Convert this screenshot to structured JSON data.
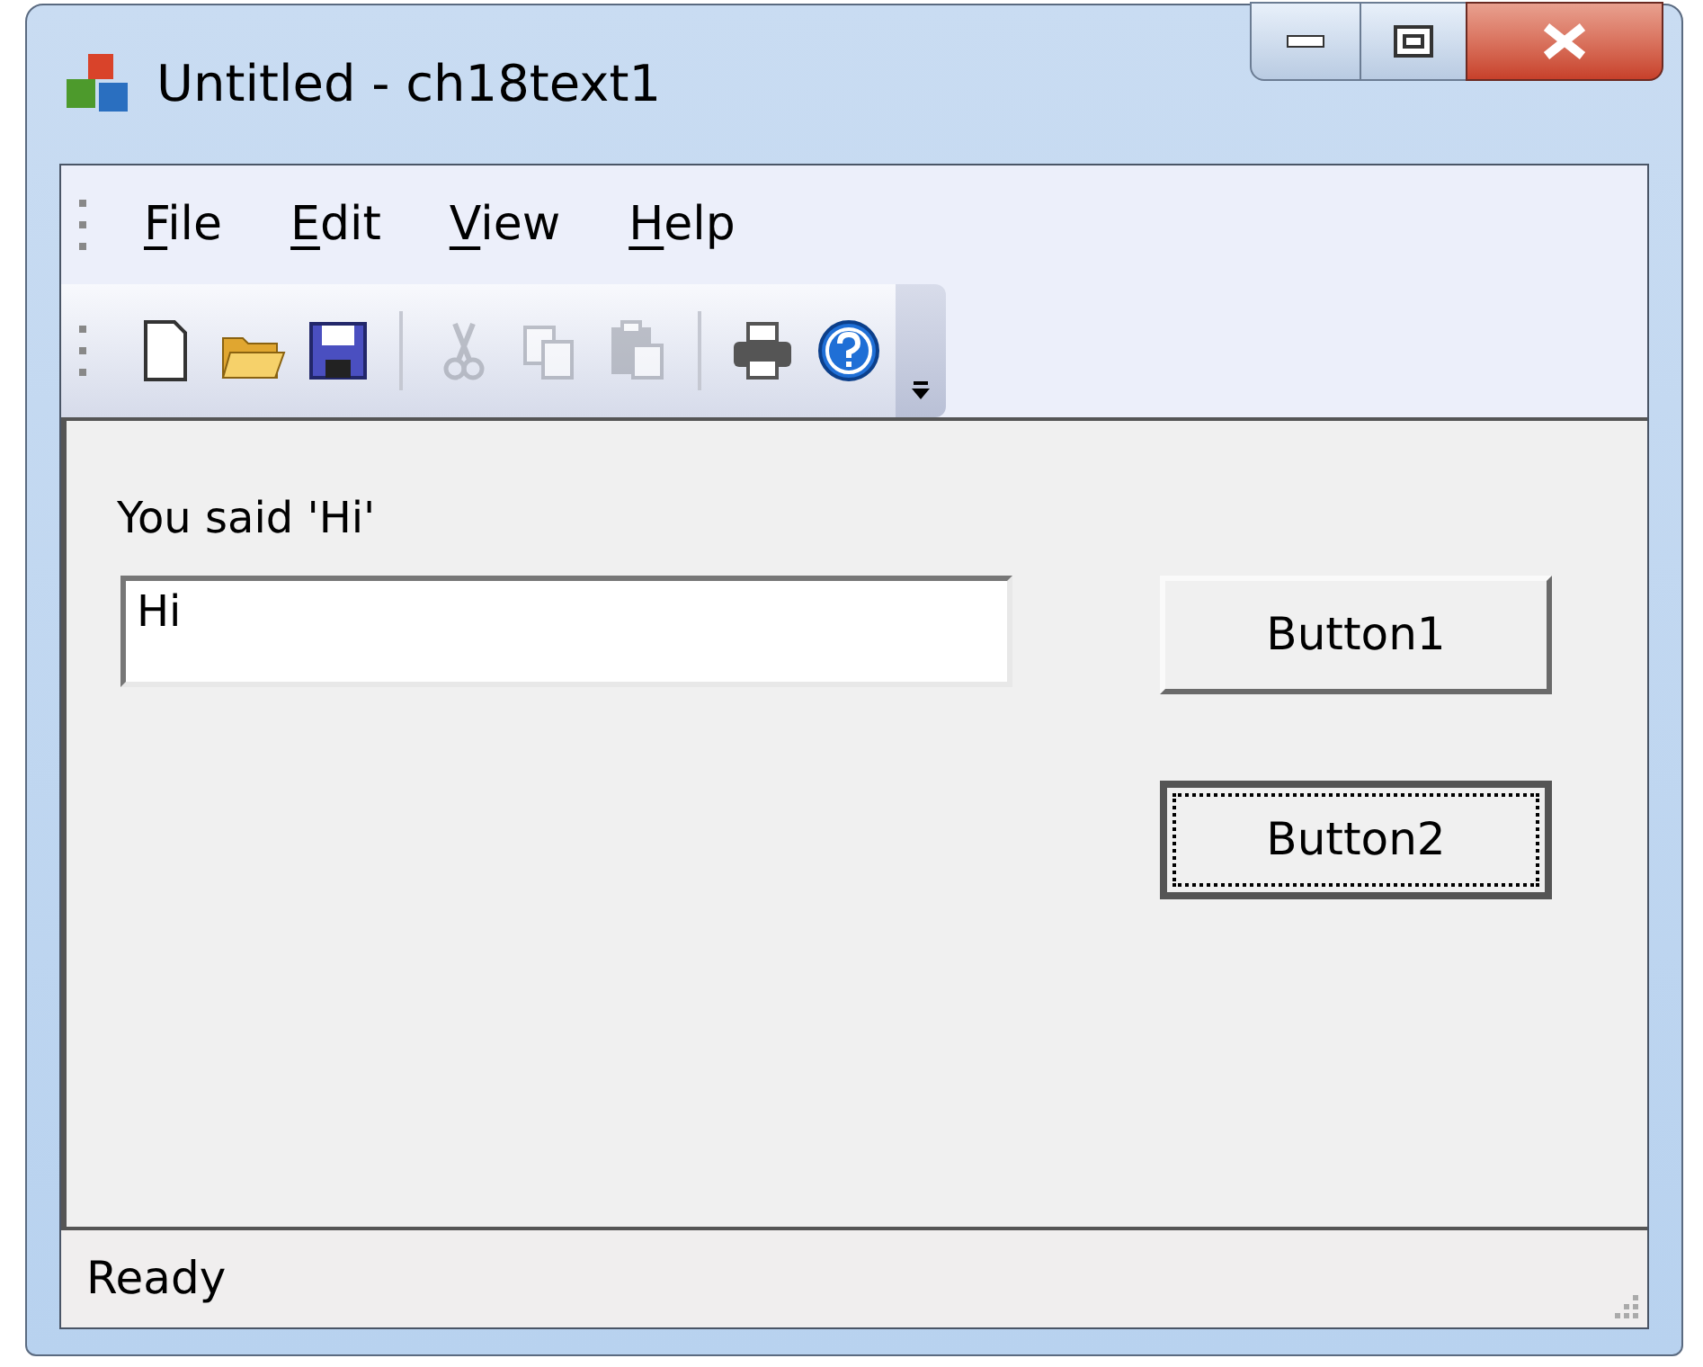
{
  "window": {
    "title": "Untitled - ch18text1"
  },
  "menu": [
    {
      "label": "File"
    },
    {
      "label": "Edit"
    },
    {
      "label": "View"
    },
    {
      "label": "Help"
    }
  ],
  "toolbar": [
    {
      "kind": "new",
      "disabled": false
    },
    {
      "kind": "open",
      "disabled": false
    },
    {
      "kind": "save",
      "disabled": false
    },
    {
      "kind": "separator"
    },
    {
      "kind": "cut",
      "disabled": true
    },
    {
      "kind": "copy",
      "disabled": true
    },
    {
      "kind": "paste",
      "disabled": true
    },
    {
      "kind": "separator"
    },
    {
      "kind": "print",
      "disabled": false
    },
    {
      "kind": "help",
      "disabled": false
    }
  ],
  "content": {
    "label": "You said 'Hi'",
    "field": {
      "value": "Hi"
    },
    "buttons": [
      {
        "label": "Button1",
        "focused": false
      },
      {
        "label": "Button2",
        "focused": true
      }
    ]
  },
  "status_bar": {
    "text": "Ready"
  }
}
